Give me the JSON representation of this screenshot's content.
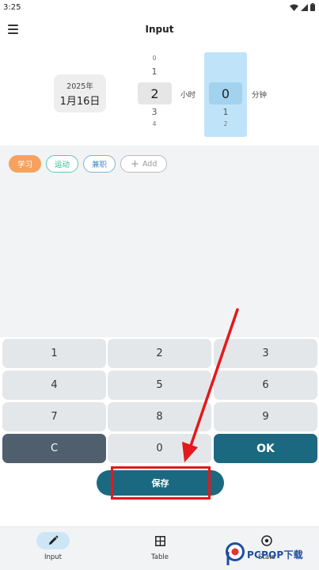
{
  "status_bar": {
    "time": "3:25"
  },
  "app_bar": {
    "title": "Input"
  },
  "date": {
    "year": "2025年",
    "day": "1月16日"
  },
  "hour_picker": {
    "above2": "0",
    "above1": "1",
    "selected": "2",
    "below1": "3",
    "below2": "4",
    "unit": "小时"
  },
  "minute_picker": {
    "selected": "0",
    "below1": "1",
    "below2": "2",
    "unit": "分钟"
  },
  "tags": {
    "study": "学习",
    "sport": "运动",
    "part_time": "兼职",
    "add": "Add"
  },
  "keypad": {
    "k1": "1",
    "k2": "2",
    "k3": "3",
    "k4": "4",
    "k5": "5",
    "k6": "6",
    "k7": "7",
    "k8": "8",
    "k9": "9",
    "clear": "C",
    "k0": "0",
    "ok": "OK"
  },
  "save_label": "保存",
  "nav": {
    "input": "Input",
    "table": "Table",
    "stats": "Stats"
  },
  "watermark": {
    "text": "PCPOP下载"
  },
  "colors": {
    "accent": "#1a6980",
    "study_tag": "#f5a25f",
    "highlight": "#e3191c",
    "minute_column": "#bfe4f9"
  },
  "icons": {
    "menu": "hamburger-icon",
    "input_nav": "pencil-icon",
    "table_nav": "grid-icon",
    "stats_nav": "target-icon"
  }
}
